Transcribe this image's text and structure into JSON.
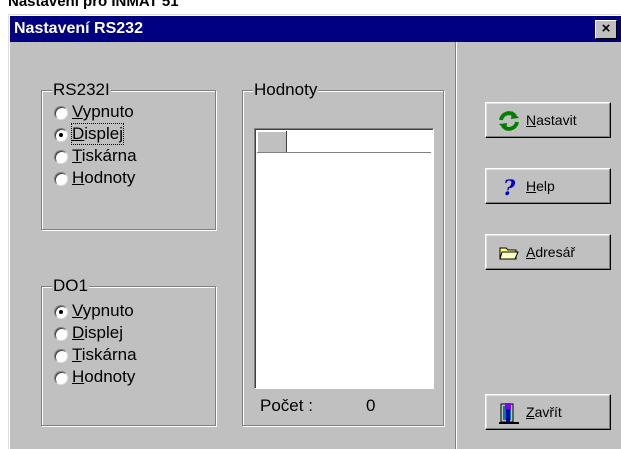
{
  "page_caption": "Nastavení pro INMAT 51",
  "window": {
    "title": "Nastavení RS232",
    "close_glyph": "×"
  },
  "group_rs232": {
    "title": "RS232I",
    "options": [
      {
        "pre": "",
        "ul": "V",
        "post": "ypnuto",
        "selected": false
      },
      {
        "pre": "",
        "ul": "D",
        "post": "isplej",
        "selected": true
      },
      {
        "pre": "",
        "ul": "T",
        "post": "iskárna",
        "selected": false
      },
      {
        "pre": "",
        "ul": "H",
        "post": "odnoty",
        "selected": false
      }
    ]
  },
  "group_do1": {
    "title": "DO1",
    "options": [
      {
        "pre": "",
        "ul": "V",
        "post": "ypnuto",
        "selected": true
      },
      {
        "pre": "",
        "ul": "D",
        "post": "isplej",
        "selected": false
      },
      {
        "pre": "",
        "ul": "T",
        "post": "iskárna",
        "selected": false
      },
      {
        "pre": "",
        "ul": "H",
        "post": "odnoty",
        "selected": false
      }
    ]
  },
  "group_values": {
    "title": "Hodnoty"
  },
  "count": {
    "label": "Počet :",
    "value": "0"
  },
  "buttons": {
    "nastavit": {
      "ul": "N",
      "post": "astavit",
      "icon": "refresh-icon",
      "color": "#008000"
    },
    "help": {
      "ul": "H",
      "post": "elp",
      "icon": "question-icon",
      "color": "#0000c0"
    },
    "adresar": {
      "ul": "A",
      "post": "dresář",
      "icon": "folder-icon",
      "color": "#ffff80"
    },
    "zavrit": {
      "ul": "Z",
      "post": "avřít",
      "icon": "exit-door-icon",
      "color": "#0000c0"
    }
  },
  "colors": {
    "titlebar": "#000080",
    "face": "#c0c0c0"
  }
}
